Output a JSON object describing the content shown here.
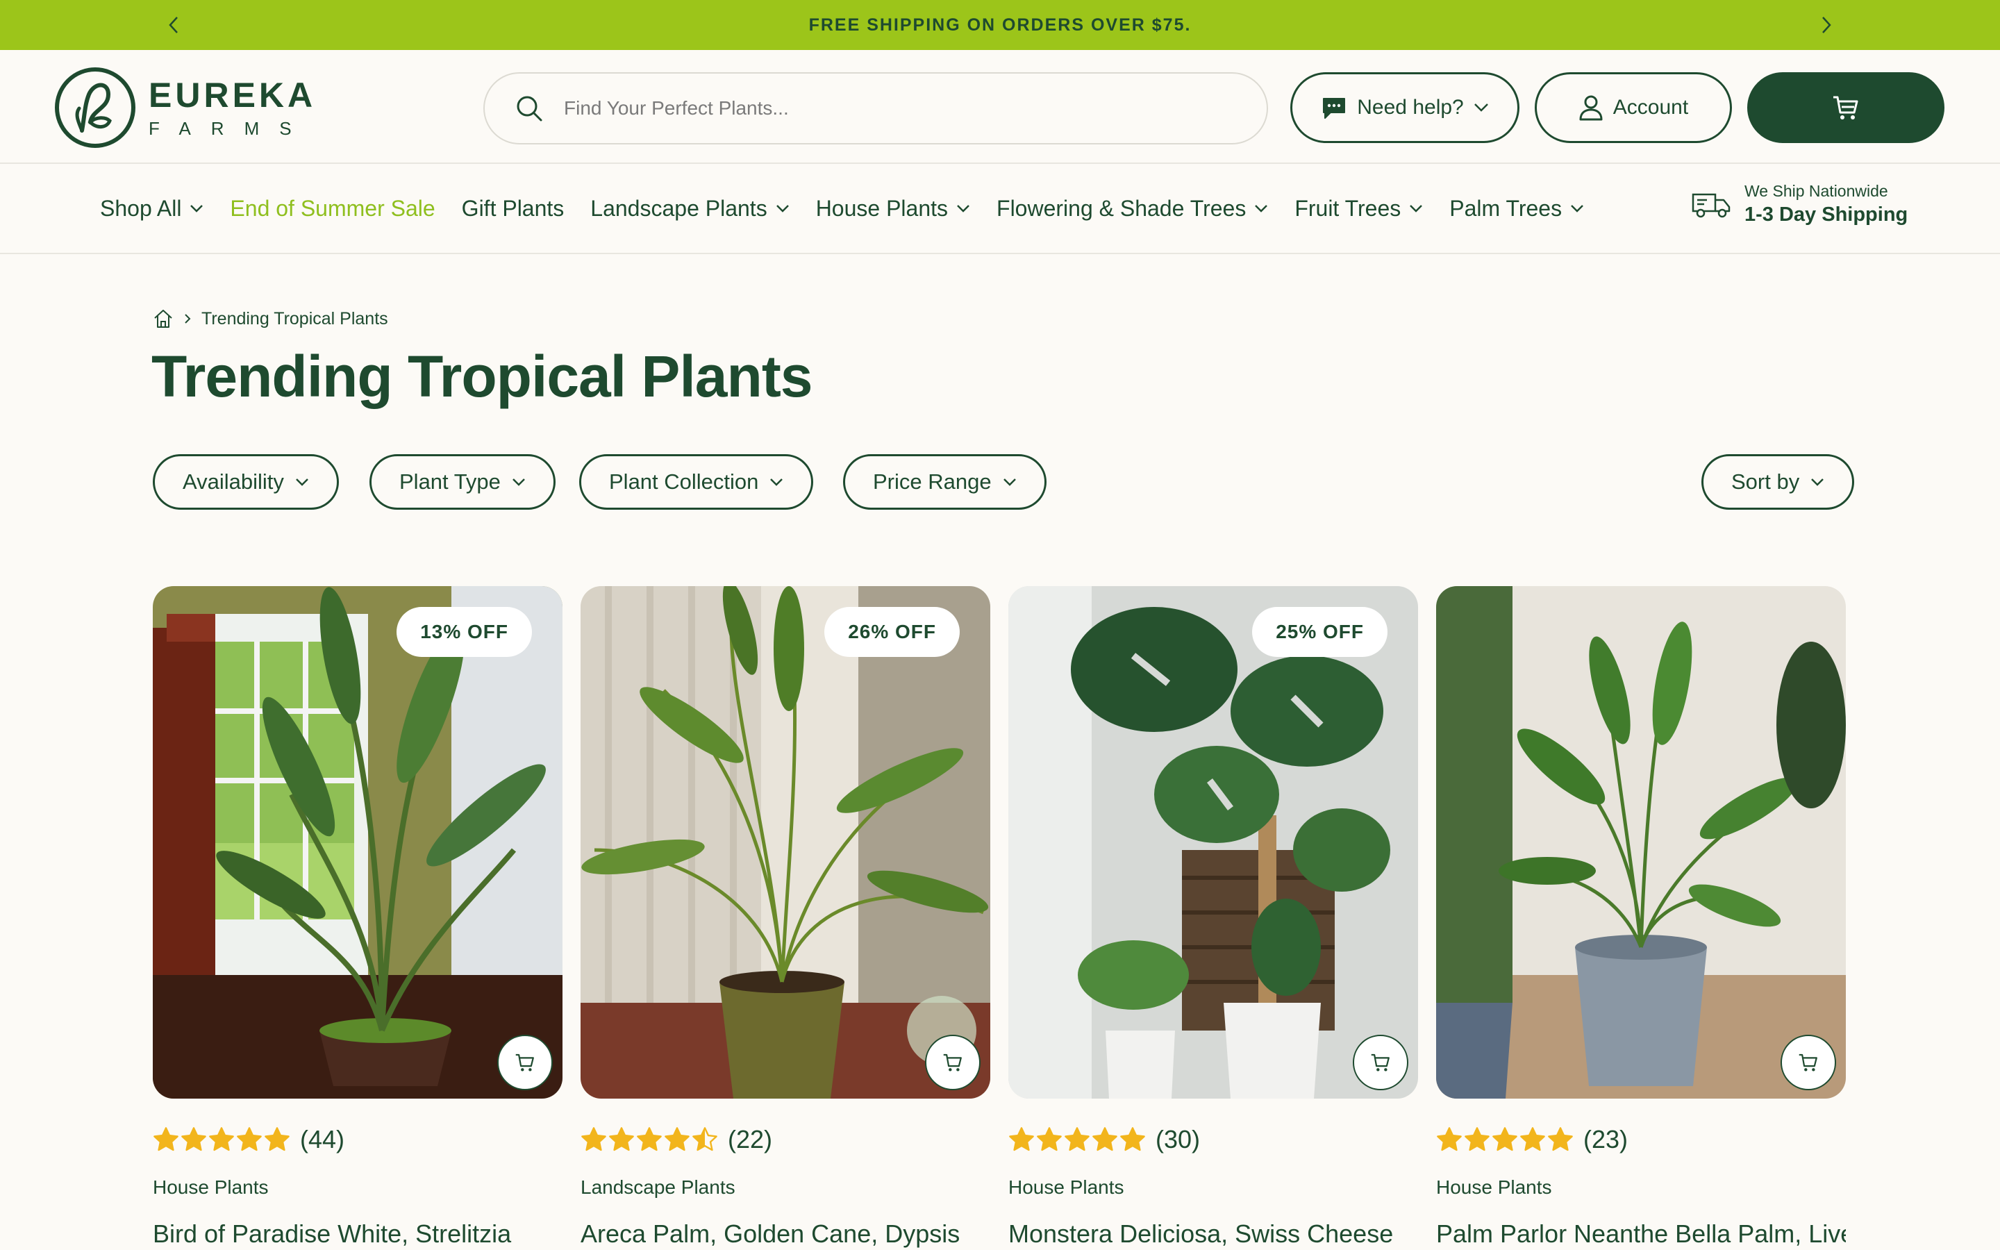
{
  "announcement": {
    "text": "FREE SHIPPING ON ORDERS OVER $75."
  },
  "brand": {
    "name": "EUREKA",
    "sub": "FARMS"
  },
  "search": {
    "placeholder": "Find Your Perfect Plants..."
  },
  "header": {
    "help_label": "Need help?",
    "account_label": "Account"
  },
  "nav": {
    "items": [
      {
        "label": "Shop All"
      },
      {
        "label": "End of Summer Sale"
      },
      {
        "label": "Gift Plants"
      },
      {
        "label": "Landscape Plants"
      },
      {
        "label": "House Plants"
      },
      {
        "label": "Flowering & Shade Trees"
      },
      {
        "label": "Fruit Trees"
      },
      {
        "label": "Palm Trees"
      }
    ],
    "shipping": {
      "line1": "We Ship Nationwide",
      "line2": "1-3 Day Shipping"
    }
  },
  "breadcrumb": {
    "current": "Trending Tropical Plants"
  },
  "page": {
    "title": "Trending Tropical Plants"
  },
  "filters": {
    "availability": "Availability",
    "plant_type": "Plant Type",
    "plant_collection": "Plant Collection",
    "price_range": "Price Range",
    "sort": "Sort by"
  },
  "products": [
    {
      "badge": "13% OFF",
      "rating": 5,
      "reviews": "(44)",
      "category": "House Plants",
      "name": "Bird of Paradise White, Strelitzia"
    },
    {
      "badge": "26% OFF",
      "rating": 4.5,
      "reviews": "(22)",
      "category": "Landscape Plants",
      "name": "Areca Palm, Golden Cane, Dypsis"
    },
    {
      "badge": "25% OFF",
      "rating": 5,
      "reviews": "(30)",
      "category": "House Plants",
      "name": "Monstera Deliciosa, Swiss Cheese"
    },
    {
      "badge": "",
      "rating": 5,
      "reviews": "(23)",
      "category": "House Plants",
      "name": "Palm Parlor Neanthe Bella Palm, Live"
    }
  ],
  "colors": {
    "brand_green": "#1e4a2f",
    "accent_lime": "#9cc51a",
    "star_gold": "#f2b51c"
  }
}
